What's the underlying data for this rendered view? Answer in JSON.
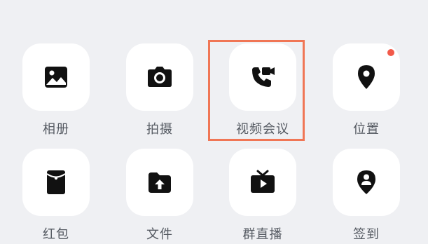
{
  "grid": {
    "items": [
      {
        "label": "相册",
        "icon": "photo-album-icon",
        "badge": false
      },
      {
        "label": "拍摄",
        "icon": "camera-icon",
        "badge": false
      },
      {
        "label": "视频会议",
        "icon": "video-call-icon",
        "badge": false,
        "highlighted": true
      },
      {
        "label": "位置",
        "icon": "location-pin-icon",
        "badge": true
      },
      {
        "label": "红包",
        "icon": "red-envelope-icon",
        "badge": false
      },
      {
        "label": "文件",
        "icon": "file-upload-icon",
        "badge": false
      },
      {
        "label": "群直播",
        "icon": "live-tv-icon",
        "badge": false
      },
      {
        "label": "签到",
        "icon": "check-in-icon",
        "badge": false
      }
    ]
  },
  "colors": {
    "background": "#eff0f3",
    "tile": "#ffffff",
    "icon": "#111111",
    "label": "#555a62",
    "badge": "#f25a4a",
    "highlight": "#f07655"
  }
}
